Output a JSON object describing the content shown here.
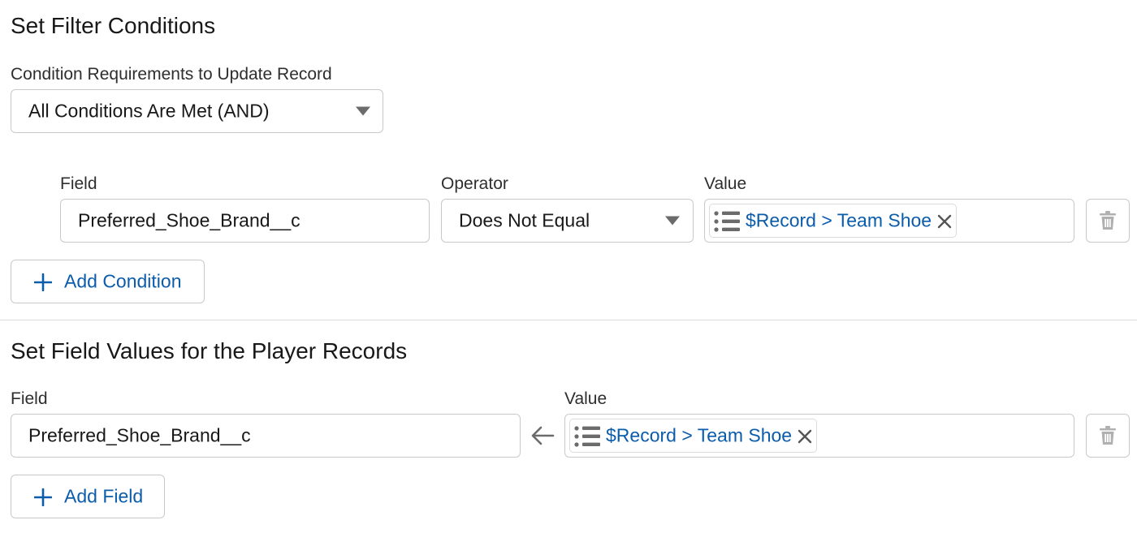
{
  "filter_section": {
    "title": "Set Filter Conditions",
    "requirement_label": "Condition Requirements to Update Record",
    "requirement_value": "All Conditions Are Met (AND)",
    "headers": {
      "field": "Field",
      "operator": "Operator",
      "value": "Value"
    },
    "condition": {
      "field": "Preferred_Shoe_Brand__c",
      "operator": "Does Not Equal",
      "value": "$Record > Team Shoe"
    },
    "add_button": "Add Condition"
  },
  "values_section": {
    "title": "Set Field Values for the Player Records",
    "headers": {
      "field": "Field",
      "value": "Value"
    },
    "assignment": {
      "field": "Preferred_Shoe_Brand__c",
      "value": "$Record > Team Shoe"
    },
    "add_button": "Add Field"
  },
  "icons": {
    "resource": "list-icon",
    "remove": "close-icon",
    "delete": "trash-icon",
    "add": "plus-icon",
    "assign": "arrow-left-icon",
    "dropdown": "chevron-down-icon"
  },
  "colors": {
    "link": "#0b5cab",
    "border": "#c9c9c9",
    "icon": "#6b6b6b"
  }
}
